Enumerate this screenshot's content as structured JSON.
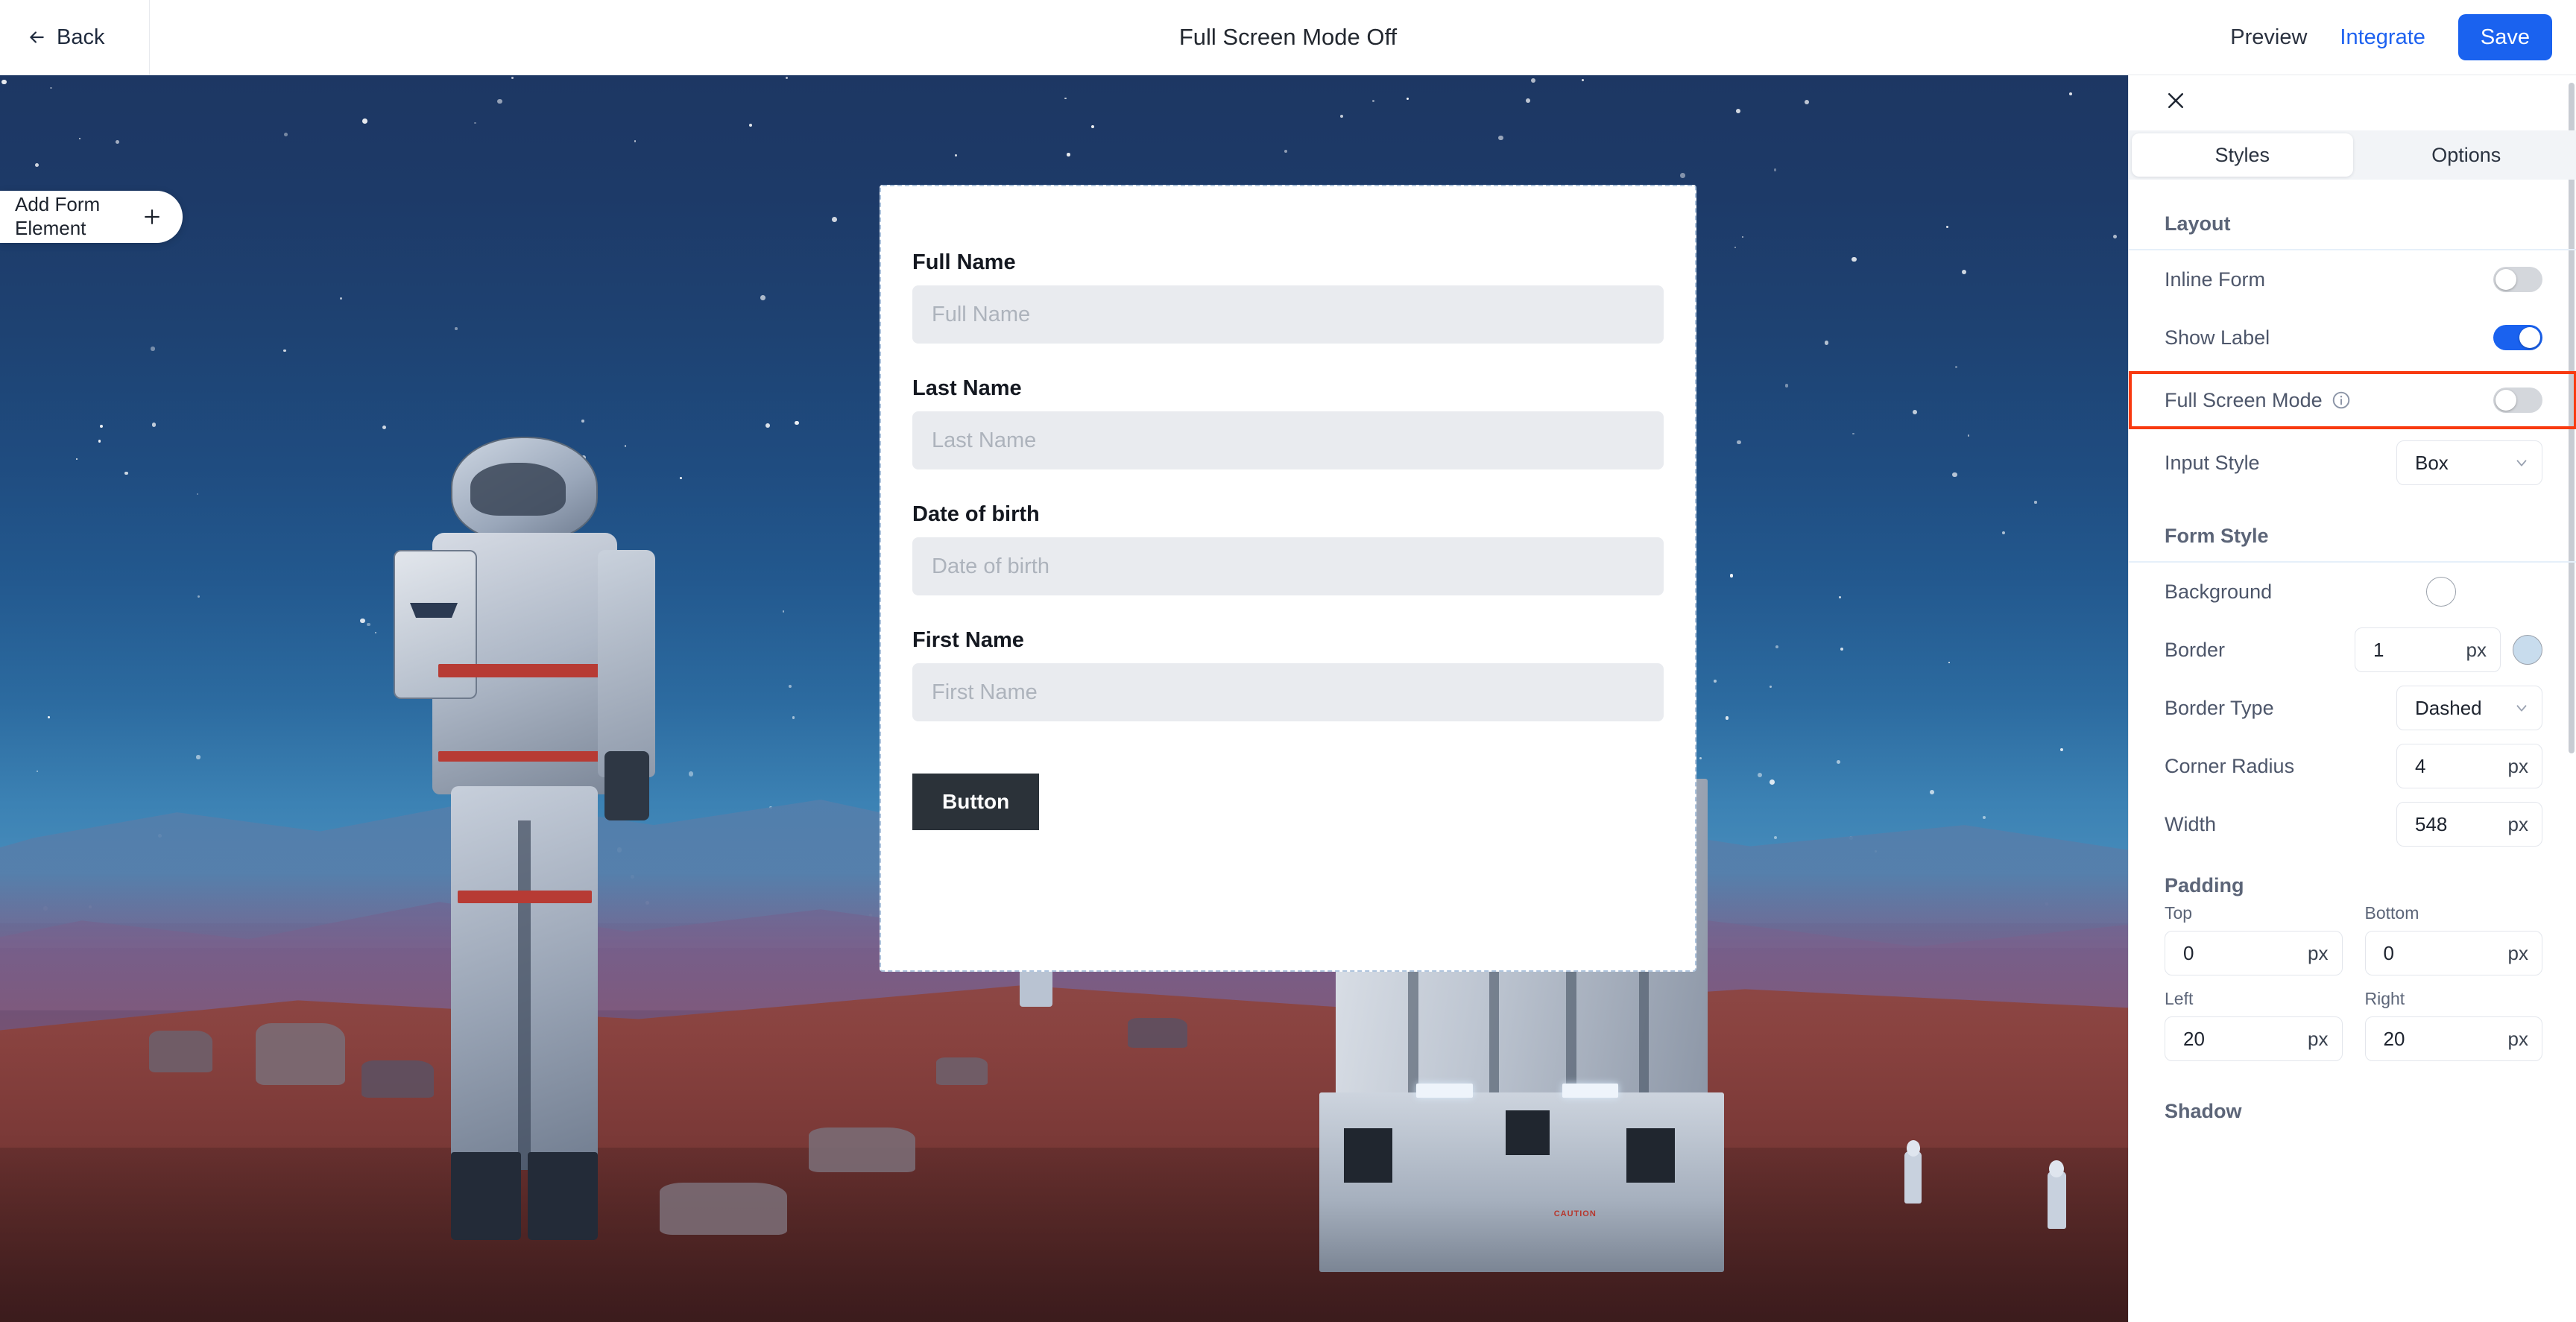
{
  "topbar": {
    "back_label": "Back",
    "back_icon": "arrow-left-icon",
    "title": "Full Screen Mode Off",
    "preview_label": "Preview",
    "integrate_label": "Integrate",
    "save_label": "Save",
    "integrate_color": "#1e62f0",
    "save_bg": "#1a62ef"
  },
  "canvas": {
    "add_form_element_label": "Add Form Element",
    "add_form_element_icon": "plus-icon"
  },
  "form": {
    "fields": [
      {
        "label": "Full Name",
        "placeholder": "Full Name",
        "value": ""
      },
      {
        "label": "Last Name",
        "placeholder": "Last Name",
        "value": ""
      },
      {
        "label": "Date of birth",
        "placeholder": "Date of birth",
        "value": ""
      },
      {
        "label": "First Name",
        "placeholder": "First Name",
        "value": ""
      }
    ],
    "button_label": "Button",
    "button_bg": "#2b3239",
    "border_style": "dashed",
    "border_color": "#aec4dd",
    "input_bg": "#e9ebef"
  },
  "panel": {
    "close_icon": "close-icon",
    "tabs": [
      {
        "label": "Styles",
        "active": true
      },
      {
        "label": "Options",
        "active": false
      }
    ],
    "layout": {
      "title": "Layout",
      "rows": [
        {
          "label": "Inline Form",
          "type": "toggle",
          "on": false
        },
        {
          "label": "Show Label",
          "type": "toggle",
          "on": true
        },
        {
          "label": "Full Screen Mode",
          "type": "toggle",
          "on": false,
          "info_icon": "info-icon",
          "highlighted": true
        },
        {
          "label": "Input Style",
          "type": "select",
          "value": "Box"
        }
      ]
    },
    "form_style": {
      "title": "Form Style",
      "background_label": "Background",
      "background_swatch": "#ffffff",
      "border_label": "Border",
      "border_value": "1",
      "border_unit": "px",
      "border_swatch": "#c8dced",
      "border_type_label": "Border Type",
      "border_type_value": "Dashed",
      "corner_radius_label": "Corner Radius",
      "corner_radius_value": "4",
      "corner_radius_unit": "px",
      "width_label": "Width",
      "width_value": "548",
      "width_unit": "px"
    },
    "padding": {
      "title": "Padding",
      "cells": [
        {
          "label": "Top",
          "value": "0",
          "unit": "px"
        },
        {
          "label": "Bottom",
          "value": "0",
          "unit": "px"
        },
        {
          "label": "Left",
          "value": "20",
          "unit": "px"
        },
        {
          "label": "Right",
          "value": "20",
          "unit": "px"
        }
      ]
    },
    "shadow": {
      "title": "Shadow"
    },
    "highlight_color": "#f83a10"
  }
}
